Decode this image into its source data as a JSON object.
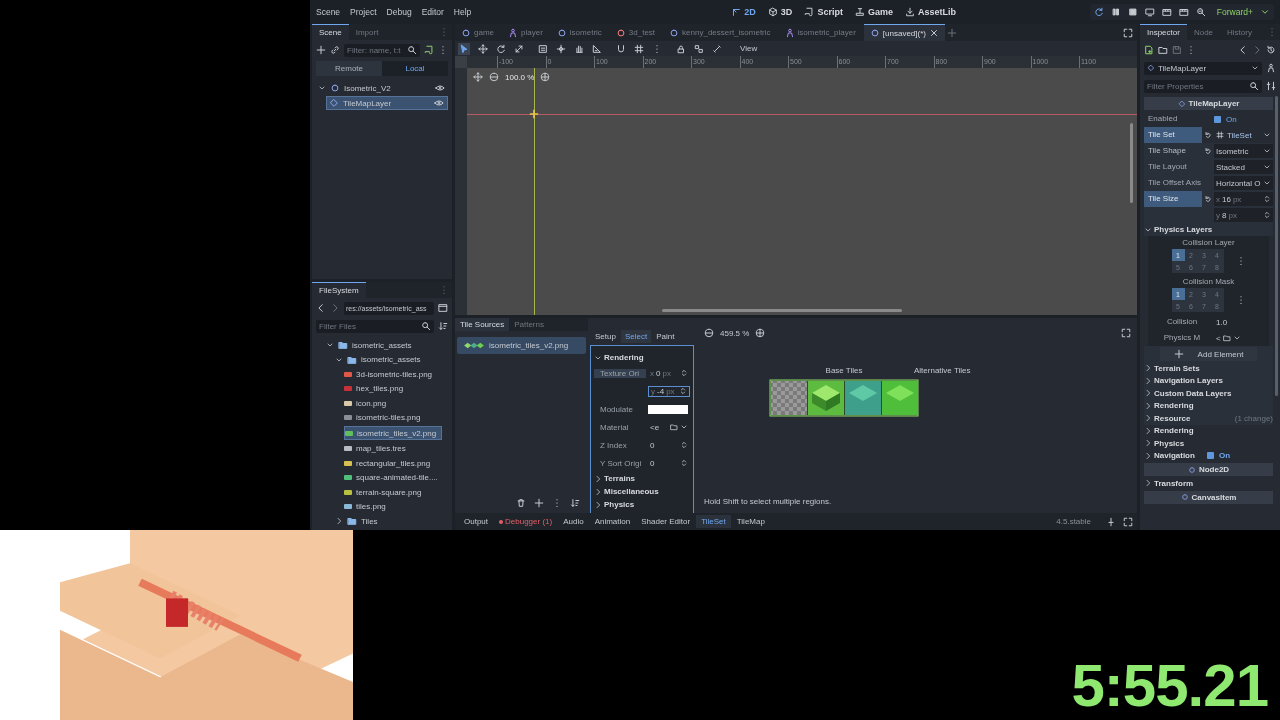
{
  "menu": [
    "Scene",
    "Project",
    "Debug",
    "Editor",
    "Help"
  ],
  "workspaces": [
    {
      "label": "2D",
      "selected": true
    },
    {
      "label": "3D",
      "selected": false
    },
    {
      "label": "Script",
      "selected": false
    },
    {
      "label": "Game",
      "selected": false
    },
    {
      "label": "AssetLib",
      "selected": false
    }
  ],
  "renderer": "Forward+",
  "scene_dock": {
    "tabs": [
      {
        "label": "Scene",
        "selected": true
      },
      {
        "label": "Import",
        "selected": false
      }
    ],
    "filter": {
      "placeholder": "Filter: name, t:t"
    },
    "modes": [
      {
        "label": "Remote",
        "selected": false
      },
      {
        "label": "Local",
        "selected": true
      }
    ],
    "tree": [
      {
        "name": "Isometric_V2",
        "kind": "node2d",
        "selected": false,
        "expanded": true,
        "children": [
          {
            "name": "TileMapLayer",
            "kind": "tilemap",
            "selected": true
          }
        ]
      }
    ]
  },
  "filesystem": {
    "title": "FileSystem",
    "path": "res://assets/isometric_ass",
    "filter": {
      "placeholder": "Filter Files"
    },
    "tree": [
      {
        "name": "isometric_assets",
        "kind": "folder",
        "expanded": true,
        "selected": false,
        "children": [
          {
            "name": "isometric_assets",
            "kind": "folder",
            "expanded": true,
            "selected": false,
            "children": [
              {
                "name": "3d-isometric-tiles.png",
                "kind": "file",
                "color": "#e0574a",
                "selected": false
              },
              {
                "name": "hex_tiles.png",
                "kind": "file",
                "color": "#c8303a",
                "selected": false
              },
              {
                "name": "icon.png",
                "kind": "file",
                "color": "#d9c9a8",
                "selected": false
              },
              {
                "name": "isometric-tiles.png",
                "kind": "file",
                "color": "#8a8f96",
                "selected": false
              },
              {
                "name": "isometric_tiles_v2.png",
                "kind": "file",
                "color": "#5fbf5a",
                "selected": true
              },
              {
                "name": "map_tiles.tres",
                "kind": "file",
                "color": "#b8bcc4",
                "selected": false
              },
              {
                "name": "rectangular_tiles.png",
                "kind": "file",
                "color": "#d8c050",
                "selected": false
              },
              {
                "name": "square-animated-tile....",
                "kind": "file",
                "color": "#4fbf7a",
                "selected": false
              },
              {
                "name": "terrain-square.png",
                "kind": "file",
                "color": "#b8c040",
                "selected": false
              },
              {
                "name": "tiles.png",
                "kind": "file",
                "color": "#8ab8d8",
                "selected": false
              }
            ]
          },
          {
            "name": "Tiles",
            "kind": "folder",
            "expanded": false,
            "selected": false
          }
        ]
      }
    ]
  },
  "scene_tabs": [
    {
      "label": "game",
      "kind": "node2d",
      "selected": false
    },
    {
      "label": "player",
      "kind": "character",
      "selected": false
    },
    {
      "label": "isometric",
      "kind": "node2d",
      "selected": false
    },
    {
      "label": "3d_test",
      "kind": "node3d",
      "selected": false
    },
    {
      "label": "kenny_dessert_isometric",
      "kind": "node2d",
      "selected": false
    },
    {
      "label": "isometric_player",
      "kind": "character",
      "selected": false
    },
    {
      "label": "[unsaved](*)",
      "kind": "node2d",
      "selected": true
    }
  ],
  "viewport": {
    "view_menu": "View",
    "zoom": "100.0 %",
    "ruler": [
      "-100",
      "0",
      "100",
      "200",
      "300",
      "400",
      "500",
      "600",
      "700",
      "800",
      "900",
      "1000",
      "1100"
    ]
  },
  "tile_panel": {
    "tabs": [
      {
        "label": "Tile Sources",
        "selected": true
      },
      {
        "label": "Patterns",
        "selected": false
      }
    ],
    "sources": [
      {
        "name": "isometric_tiles_v2.png",
        "selected": true
      }
    ],
    "tools": [
      {
        "label": "Setup",
        "selected": false
      },
      {
        "label": "Select",
        "selected": true
      },
      {
        "label": "Paint",
        "selected": false
      }
    ],
    "properties": [
      {
        "kind": "section",
        "label": "Rendering",
        "expanded": true,
        "children": [
          {
            "kind": "vector",
            "label": "Texture Ori",
            "axes": [
              {
                "axis": "x",
                "value": "0",
                "unit": "px"
              },
              {
                "axis": "y",
                "value": "-4",
                "unit": "px"
              }
            ]
          },
          {
            "kind": "color",
            "label": "Modulate",
            "color": "#ffffff"
          },
          {
            "kind": "picker",
            "label": "Material",
            "value": "<e"
          },
          {
            "kind": "number",
            "label": "Z Index",
            "value": "0"
          },
          {
            "kind": "number",
            "label": "Y Sort Origi",
            "value": "0"
          }
        ]
      },
      {
        "kind": "section",
        "label": "Terrains",
        "expanded": false
      },
      {
        "kind": "section",
        "label": "Miscellaneous",
        "expanded": false
      },
      {
        "kind": "section",
        "label": "Physics",
        "expanded": false
      }
    ],
    "zoom": "459.5 %",
    "base_heading": "Base Tiles",
    "alternative_heading": "Alternative Tiles",
    "hint": "Hold Shift to select multiple regions."
  },
  "bottom_tabs": [
    {
      "label": "Output",
      "selected": false,
      "alert": false
    },
    {
      "label": "Debugger (1)",
      "selected": false,
      "alert": true
    },
    {
      "label": "Audio",
      "selected": false,
      "alert": false
    },
    {
      "label": "Animation",
      "selected": false,
      "alert": false
    },
    {
      "label": "Shader Editor",
      "selected": false,
      "alert": false
    },
    {
      "label": "TileSet",
      "selected": true,
      "alert": false
    },
    {
      "label": "TileMap",
      "selected": false,
      "alert": false
    }
  ],
  "version": "4.5.stable",
  "inspector": {
    "tabs": [
      {
        "label": "Inspector",
        "selected": true
      },
      {
        "label": "Node",
        "selected": false
      },
      {
        "label": "History",
        "selected": false
      }
    ],
    "object": "TileMapLayer",
    "filter": {
      "placeholder": "Filter Properties"
    },
    "properties": [
      {
        "kind": "category",
        "label": "TileMapLayer"
      },
      {
        "kind": "check",
        "label": "Enabled",
        "checked": true,
        "value": "On"
      },
      {
        "kind": "resource",
        "label": "Tile Set",
        "value": "TileSet",
        "expanded": true,
        "children": [
          {
            "kind": "enum",
            "label": "Tile Shape",
            "value": "Isometric",
            "modified": true
          },
          {
            "kind": "enum",
            "label": "Tile Layout",
            "value": "Stacked",
            "modified": false
          },
          {
            "kind": "enum",
            "label": "Tile Offset Axis",
            "value": "Horizontal O",
            "modified": false
          },
          {
            "kind": "vector",
            "label": "Tile Size",
            "modified": true,
            "axes": [
              {
                "axis": "x",
                "value": "16",
                "unit": "px"
              },
              {
                "axis": "y",
                "value": "8",
                "unit": "px"
              }
            ]
          },
          {
            "kind": "section",
            "label": "Physics Layers",
            "expanded": true,
            "children": [
              {
                "kind": "layers",
                "label": "Collision Layer",
                "cells": [
                  {
                    "label": "1",
                    "selected": true
                  },
                  {
                    "label": "2",
                    "selected": false
                  },
                  {
                    "label": "3",
                    "selected": false
                  },
                  {
                    "label": "4",
                    "selected": false
                  },
                  {
                    "label": "5",
                    "selected": false
                  },
                  {
                    "label": "6",
                    "selected": false
                  },
                  {
                    "label": "7",
                    "selected": false
                  },
                  {
                    "label": "8",
                    "selected": false
                  }
                ]
              },
              {
                "kind": "layers",
                "label": "Collision Mask",
                "cells": [
                  {
                    "label": "1",
                    "selected": true
                  },
                  {
                    "label": "2",
                    "selected": false
                  },
                  {
                    "label": "3",
                    "selected": false
                  },
                  {
                    "label": "4",
                    "selected": false
                  },
                  {
                    "label": "5",
                    "selected": false
                  },
                  {
                    "label": "6",
                    "selected": false
                  },
                  {
                    "label": "7",
                    "selected": false
                  },
                  {
                    "label": "8",
                    "selected": false
                  }
                ]
              },
              {
                "kind": "float",
                "label": "Collision",
                "value": "1.0"
              },
              {
                "kind": "picker",
                "label": "Physics M",
                "value": "<"
              }
            ]
          },
          {
            "kind": "add",
            "label": "Add Element"
          },
          {
            "kind": "group",
            "label": "Terrain Sets",
            "expanded": false
          },
          {
            "kind": "group",
            "label": "Navigation Layers",
            "expanded": false
          },
          {
            "kind": "group",
            "label": "Custom Data Layers",
            "expanded": false
          },
          {
            "kind": "group",
            "label": "Rendering",
            "expanded": false
          },
          {
            "kind": "group",
            "label": "Resource",
            "expanded": false,
            "note": "(1 change)"
          }
        ]
      },
      {
        "kind": "group",
        "label": "Rendering",
        "expanded": false
      },
      {
        "kind": "group",
        "label": "Physics",
        "expanded": false
      },
      {
        "kind": "group",
        "label": "Navigation",
        "expanded": false,
        "checked": true,
        "value": "On"
      },
      {
        "kind": "category",
        "label": "Node2D"
      },
      {
        "kind": "group",
        "label": "Transform",
        "expanded": false
      },
      {
        "kind": "category",
        "label": "CanvasItem"
      }
    ]
  },
  "timer": "5:55.21"
}
